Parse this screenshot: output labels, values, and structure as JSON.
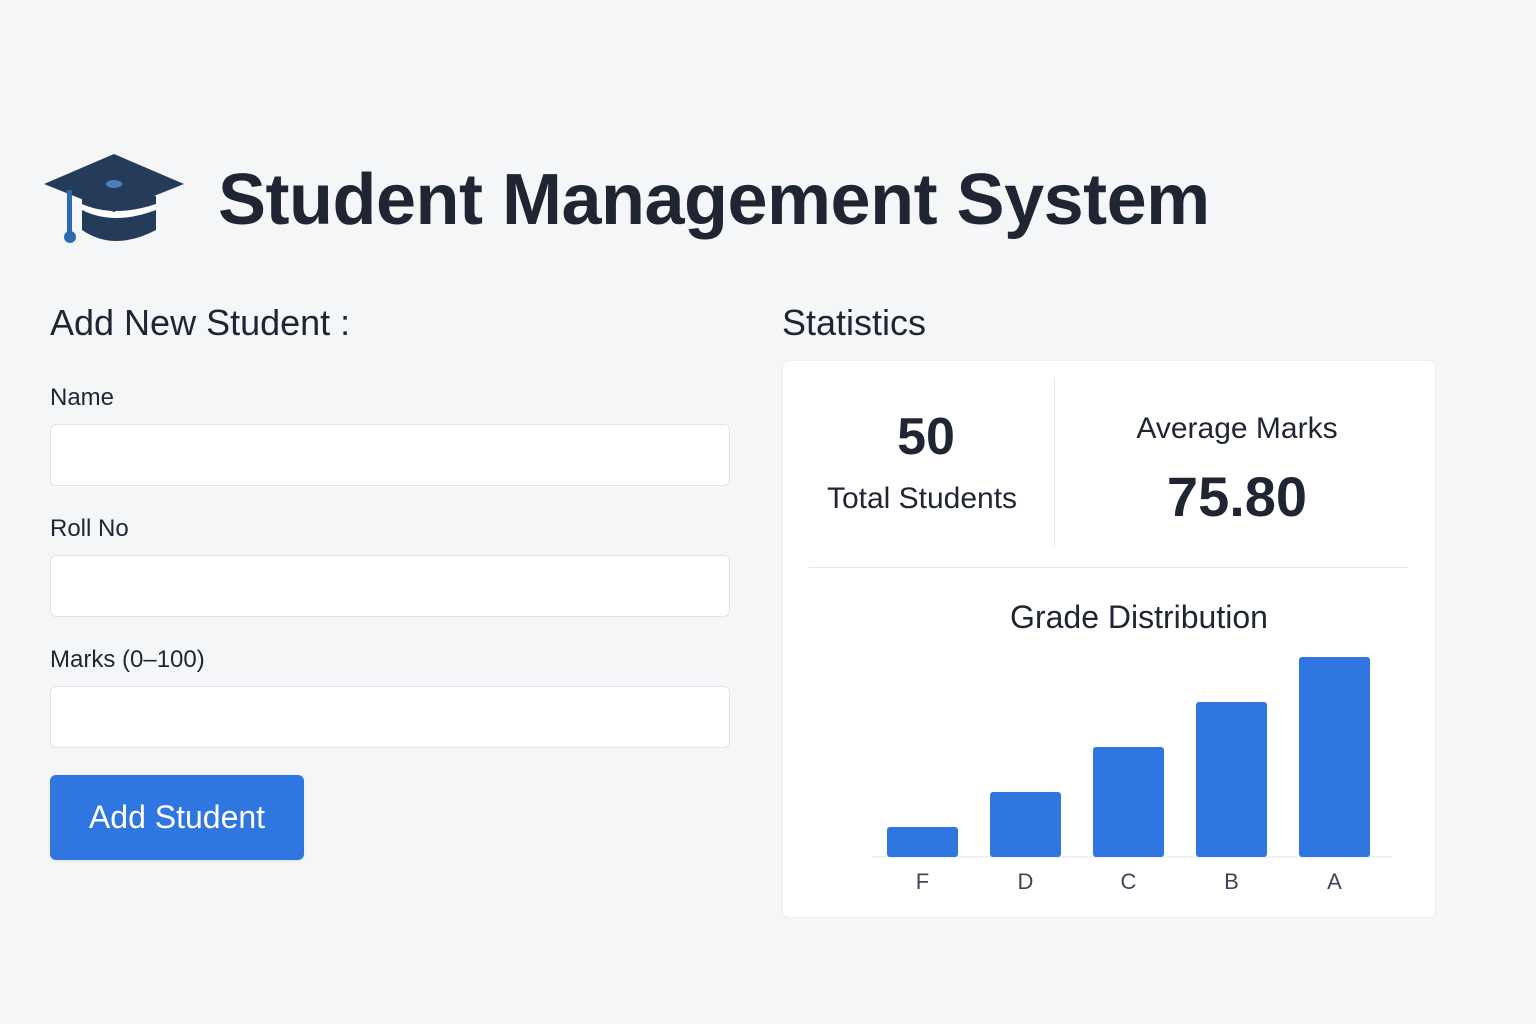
{
  "header": {
    "title": "Student Management System",
    "icon": "graduation-cap-icon"
  },
  "form": {
    "heading": "Add New Student :",
    "fields": [
      {
        "label": "Name",
        "value": "",
        "placeholder": ""
      },
      {
        "label": "Roll No",
        "value": "",
        "placeholder": ""
      },
      {
        "label": "Marks (0–100)",
        "value": "",
        "placeholder": ""
      }
    ],
    "submit_label": "Add Student"
  },
  "stats": {
    "heading": "Statistics",
    "total_students_value": "50",
    "total_students_label": "Total Students",
    "average_marks_label": "Average Marks",
    "average_marks_value": "75.80"
  },
  "chart_data": {
    "type": "bar",
    "title": "Grade Distribution",
    "categories": [
      "F",
      "D",
      "C",
      "B",
      "A"
    ],
    "values": [
      3,
      6.5,
      11,
      15.5,
      20
    ],
    "ylim": [
      0,
      20
    ],
    "xlabel": "",
    "ylabel": "",
    "grid": false,
    "legend": "none"
  },
  "colors": {
    "accent": "#2f76e0",
    "text": "#1f2533",
    "background": "#f5f6f8",
    "card": "#ffffff",
    "icon": "#243b5a"
  }
}
